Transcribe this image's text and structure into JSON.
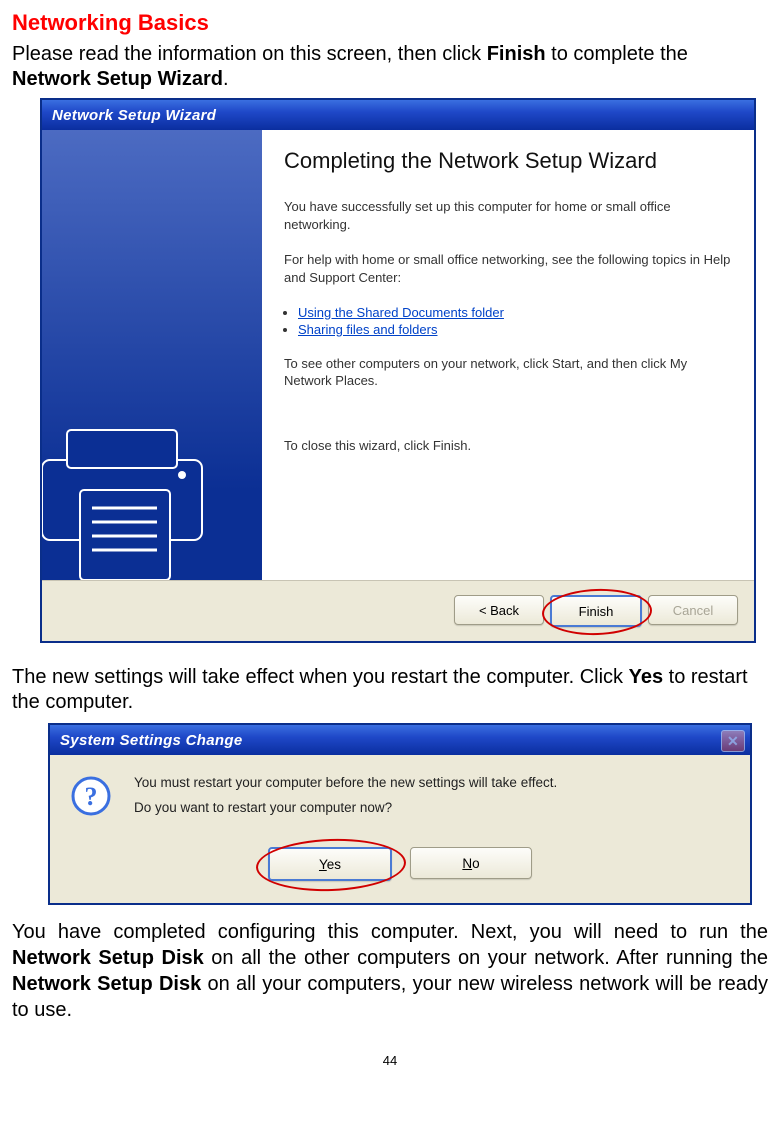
{
  "section_title": "Networking Basics",
  "intro_a": "Please read the information on this screen, then click ",
  "intro_b": "Finish",
  "intro_c": " to complete the ",
  "intro_d": "Network Setup Wizard",
  "intro_e": ".",
  "wizard": {
    "title": "Network Setup Wizard",
    "heading": "Completing the Network Setup Wizard",
    "p1": "You have successfully set up this computer for home or small office networking.",
    "p2": "For help with home or small office networking, see the following topics in Help and Support Center:",
    "link1": "Using the Shared Documents folder",
    "link2": "Sharing files and folders",
    "p3": "To see other computers on your network, click Start, and then click My Network Places.",
    "p_close": "To close this wizard, click Finish.",
    "btn_back": "< Back",
    "btn_finish": "Finish",
    "btn_cancel": "Cancel"
  },
  "para2_a": "The new settings will take effect when you restart the computer.  Click ",
  "para2_b": "Yes",
  "para2_c": " to restart the computer.",
  "dialog": {
    "title": "System Settings Change",
    "line1": "You must restart your computer before the new settings will take effect.",
    "line2": "Do you want to restart your computer now?",
    "btn_yes_u": "Y",
    "btn_yes_rest": "es",
    "btn_no_u": "N",
    "btn_no_rest": "o"
  },
  "para3_a": "You have completed configuring this computer.  Next, you will need to run the ",
  "para3_b": "Network Setup Disk",
  "para3_c": " on all the other computers on your network.  After running the ",
  "para3_d": "Network Setup Disk",
  "para3_e": " on all your computers, your new wireless network will be ready to use.",
  "page_number": "44"
}
